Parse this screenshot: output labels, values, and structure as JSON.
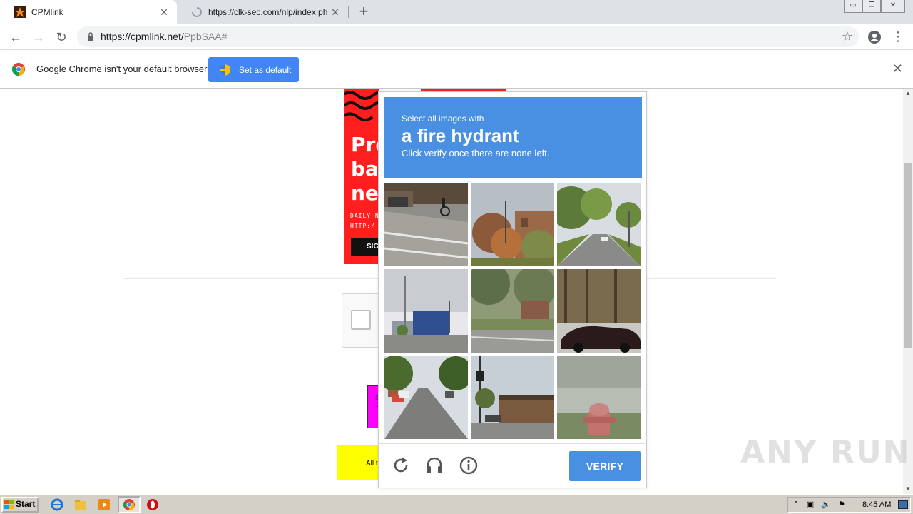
{
  "browser": {
    "tabs": [
      {
        "title": "CPMlink",
        "active": true
      },
      {
        "title": "https://clk-sec.com/nlp/index.php?a",
        "active": false,
        "loading": true
      }
    ],
    "url": {
      "host": "https://cpmlink.net/",
      "path": "PpbSAA#"
    }
  },
  "infobar": {
    "message": "Google Chrome isn't your default browser",
    "button": "Set as default"
  },
  "ad": {
    "headline_lines": [
      "Pro",
      "ba",
      "ne"
    ],
    "small_lines": [
      "DAILY N",
      "HTTP:/"
    ],
    "button": "SIG"
  },
  "page": {
    "magenta_text": [
      "S",
      "10"
    ],
    "yellow_text": "All t"
  },
  "captcha": {
    "instruction": "Select all images with",
    "target": "a fire hydrant",
    "sub_instruction": "Click verify once there are none left.",
    "verify_label": "VERIFY",
    "tiles": [
      {
        "name": "street-crossing-cyclist"
      },
      {
        "name": "autumn-trees-building"
      },
      {
        "name": "tree-lined-road"
      },
      {
        "name": "commercial-building-lot"
      },
      {
        "name": "grassy-corner-house"
      },
      {
        "name": "parked-car-woods"
      },
      {
        "name": "residential-street-cars"
      },
      {
        "name": "intersection-traffic-light"
      },
      {
        "name": "fire-hydrant-grass"
      }
    ],
    "colors": {
      "accent": "#4a90e2"
    }
  },
  "watermark": "ANY RUN",
  "taskbar": {
    "start": "Start",
    "clock": "8:45 AM"
  }
}
